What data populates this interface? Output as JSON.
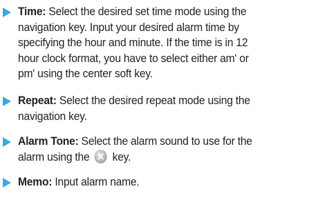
{
  "items": [
    {
      "term": "Time:",
      "lines": [
        " Select the desired set time mode using the",
        "navigation key. Input your desired alarm time by",
        "specifying the hour and minute. If the time is in 12",
        "hour clock format, you have to select either am' or",
        "pm' using the center soft key."
      ]
    },
    {
      "term": "Repeat:",
      "lines": [
        " Select the desired repeat mode using the",
        "navigation key."
      ]
    },
    {
      "term": "Alarm Tone:",
      "lines": [
        " Select the alarm sound to use for the",
        "alarm using the"
      ],
      "after_icon": "key.",
      "icon": "soft-key-icon"
    },
    {
      "term": "Memo:",
      "lines": [
        " Input alarm name."
      ]
    }
  ],
  "colors": {
    "bullet": "#36a9e1",
    "text": "#231f20"
  }
}
